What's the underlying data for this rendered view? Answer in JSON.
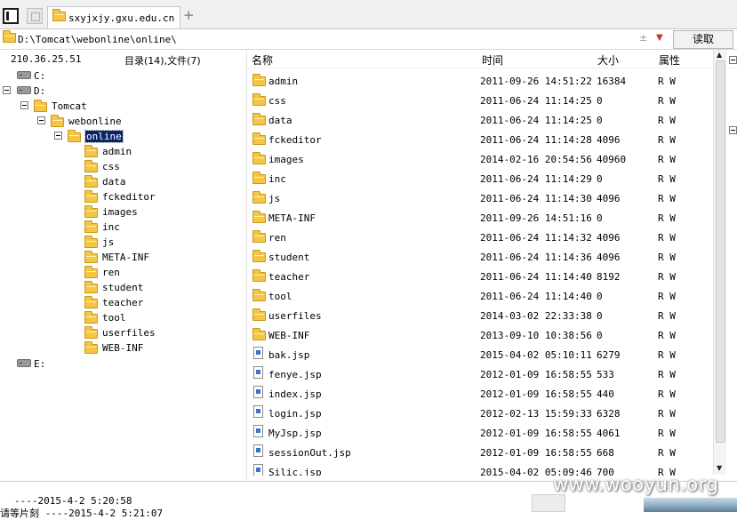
{
  "tab": {
    "title": "sxyjxjy.gxu.edu.cn"
  },
  "address": {
    "path": "D:\\Tomcat\\webonline\\online\\",
    "read_label": "读取",
    "ctrl_glyph": "±"
  },
  "left": {
    "ip": "210.36.25.51",
    "dir_summary": "目录(14),文件(7)"
  },
  "tree": [
    {
      "label": "C:",
      "type": "drive",
      "expanded": false,
      "level": 0
    },
    {
      "label": "D:",
      "type": "drive",
      "expanded": true,
      "level": 0
    },
    {
      "label": "Tomcat",
      "type": "folder",
      "expanded": true,
      "level": 1
    },
    {
      "label": "webonline",
      "type": "folder",
      "expanded": true,
      "level": 2
    },
    {
      "label": "online",
      "type": "folder",
      "expanded": true,
      "selected": true,
      "level": 3
    },
    {
      "label": "admin",
      "type": "folder",
      "level": 4
    },
    {
      "label": "css",
      "type": "folder",
      "level": 4
    },
    {
      "label": "data",
      "type": "folder",
      "level": 4
    },
    {
      "label": "fckeditor",
      "type": "folder",
      "level": 4
    },
    {
      "label": "images",
      "type": "folder",
      "level": 4
    },
    {
      "label": "inc",
      "type": "folder",
      "level": 4
    },
    {
      "label": "js",
      "type": "folder",
      "level": 4
    },
    {
      "label": "META-INF",
      "type": "folder",
      "level": 4
    },
    {
      "label": "ren",
      "type": "folder",
      "level": 4
    },
    {
      "label": "student",
      "type": "folder",
      "level": 4
    },
    {
      "label": "teacher",
      "type": "folder",
      "level": 4
    },
    {
      "label": "tool",
      "type": "folder",
      "level": 4
    },
    {
      "label": "userfiles",
      "type": "folder",
      "level": 4
    },
    {
      "label": "WEB-INF",
      "type": "folder",
      "level": 4
    },
    {
      "label": "E:",
      "type": "drive",
      "expanded": false,
      "level": 0
    }
  ],
  "columns": {
    "name": "名称",
    "time": "时间",
    "size": "大小",
    "attr": "属性"
  },
  "files": [
    {
      "name": "admin",
      "type": "folder",
      "time": "2011-09-26 14:51:22",
      "size": "16384",
      "attr": "R W"
    },
    {
      "name": "css",
      "type": "folder",
      "time": "2011-06-24 11:14:25",
      "size": "0",
      "attr": "R W"
    },
    {
      "name": "data",
      "type": "folder",
      "time": "2011-06-24 11:14:25",
      "size": "0",
      "attr": "R W"
    },
    {
      "name": "fckeditor",
      "type": "folder",
      "time": "2011-06-24 11:14:28",
      "size": "4096",
      "attr": "R W"
    },
    {
      "name": "images",
      "type": "folder",
      "time": "2014-02-16 20:54:56",
      "size": "40960",
      "attr": "R W"
    },
    {
      "name": "inc",
      "type": "folder",
      "time": "2011-06-24 11:14:29",
      "size": "0",
      "attr": "R W"
    },
    {
      "name": "js",
      "type": "folder",
      "time": "2011-06-24 11:14:30",
      "size": "4096",
      "attr": "R W"
    },
    {
      "name": "META-INF",
      "type": "folder",
      "time": "2011-09-26 14:51:16",
      "size": "0",
      "attr": "R W"
    },
    {
      "name": "ren",
      "type": "folder",
      "time": "2011-06-24 11:14:32",
      "size": "4096",
      "attr": "R W"
    },
    {
      "name": "student",
      "type": "folder",
      "time": "2011-06-24 11:14:36",
      "size": "4096",
      "attr": "R W"
    },
    {
      "name": "teacher",
      "type": "folder",
      "time": "2011-06-24 11:14:40",
      "size": "8192",
      "attr": "R W"
    },
    {
      "name": "tool",
      "type": "folder",
      "time": "2011-06-24 11:14:40",
      "size": "0",
      "attr": "R W"
    },
    {
      "name": "userfiles",
      "type": "folder",
      "time": "2014-03-02 22:33:38",
      "size": "0",
      "attr": "R W"
    },
    {
      "name": "WEB-INF",
      "type": "folder",
      "time": "2013-09-10 10:38:56",
      "size": "0",
      "attr": "R W"
    },
    {
      "name": "bak.jsp",
      "type": "file",
      "time": "2015-04-02 05:10:11",
      "size": "6279",
      "attr": "R W"
    },
    {
      "name": "fenye.jsp",
      "type": "file",
      "time": "2012-01-09 16:58:55",
      "size": "533",
      "attr": "R W"
    },
    {
      "name": "index.jsp",
      "type": "file",
      "time": "2012-01-09 16:58:55",
      "size": "440",
      "attr": "R W"
    },
    {
      "name": "login.jsp",
      "type": "file",
      "time": "2012-02-13 15:59:33",
      "size": "6328",
      "attr": "R W"
    },
    {
      "name": "MyJsp.jsp",
      "type": "file",
      "time": "2012-01-09 16:58:55",
      "size": "4061",
      "attr": "R W"
    },
    {
      "name": "sessionOut.jsp",
      "type": "file",
      "time": "2012-01-09 16:58:55",
      "size": "668",
      "attr": "R W"
    },
    {
      "name": "Silic.jsp",
      "type": "file",
      "time": "2015-04-02 05:09:46",
      "size": "700",
      "attr": "R W"
    }
  ],
  "log": {
    "line1": "----2015-4-2 5:20:58",
    "line2": "请等片刻      ----2015-4-2 5:21:07"
  },
  "watermark": "www.wooyun.org"
}
